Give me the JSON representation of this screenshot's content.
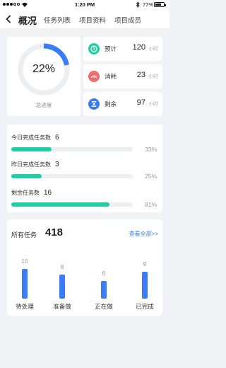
{
  "status_bar": {
    "time": "1:20 PM",
    "battery": "77%",
    "battery_level": 0.77
  },
  "nav": {
    "title": "概况",
    "tabs": [
      "任务列表",
      "项目资料",
      "项目成员"
    ]
  },
  "overview": {
    "percent_text": "22%",
    "percent": 22,
    "caption": "总进度"
  },
  "stats": [
    {
      "label": "预计",
      "value": "120",
      "unit": "小时",
      "color": "#20cfa5",
      "icon": "clock-icon"
    },
    {
      "label": "消耗",
      "value": "23",
      "unit": "小时",
      "color": "#f06b6b",
      "icon": "gauge-icon"
    },
    {
      "label": "剩余",
      "value": "97",
      "unit": "小时",
      "color": "#3a7bf6",
      "icon": "hourglass-icon"
    }
  ],
  "progress": [
    {
      "label": "今日完成任务数",
      "count": "6",
      "percent_text": "33%",
      "percent": 33
    },
    {
      "label": "昨日完成任务数",
      "count": "3",
      "percent_text": "25%",
      "percent": 25
    },
    {
      "label": "剩余任务数",
      "count": "16",
      "percent_text": "81%",
      "percent": 81
    }
  ],
  "tasks": {
    "title": "所有任务",
    "total": "418",
    "view_all": "查看全部>>"
  },
  "chart_data": {
    "type": "bar",
    "categories": [
      "待处理",
      "准备做",
      "正在做",
      "已完成"
    ],
    "values": [
      10,
      8,
      6,
      9
    ],
    "ylim": [
      0,
      10
    ],
    "color": "#3a7bf6"
  }
}
